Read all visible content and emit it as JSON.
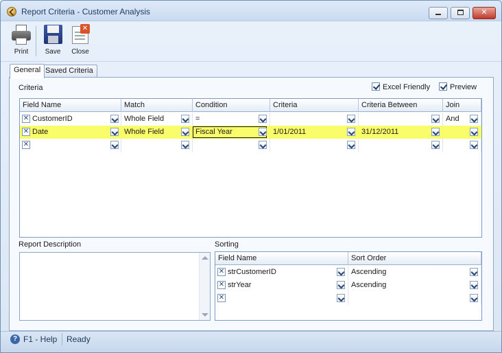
{
  "window": {
    "title": "Report Criteria - Customer Analysis"
  },
  "toolbar": {
    "print_label": "Print",
    "save_label": "Save",
    "close_label": "Close"
  },
  "tabs": [
    {
      "label": "General",
      "active": true
    },
    {
      "label": "Saved Criteria",
      "active": false
    }
  ],
  "criteria": {
    "section_label": "Criteria",
    "excel_friendly": {
      "label": "Excel Friendly",
      "checked": true
    },
    "preview": {
      "label": "Preview",
      "checked": true
    },
    "columns": [
      "Field Name",
      "Match",
      "Condition",
      "Criteria",
      "Criteria Between",
      "Join"
    ],
    "rows": [
      {
        "field": "CustomerID",
        "match": "Whole Field",
        "condition": "=",
        "criteria": "",
        "between": "",
        "join": "And",
        "selected": false
      },
      {
        "field": "Date",
        "match": "Whole Field",
        "condition": "Fiscal Year",
        "criteria": "1/01/2011",
        "between": "31/12/2011",
        "join": "",
        "selected": true
      },
      {
        "field": "",
        "match": "",
        "condition": "",
        "criteria": "",
        "between": "",
        "join": "",
        "selected": false
      }
    ]
  },
  "description": {
    "label": "Report Description",
    "value": ""
  },
  "sorting": {
    "label": "Sorting",
    "columns": [
      "Field Name",
      "Sort Order"
    ],
    "rows": [
      {
        "field": "strCustomerID",
        "order": "Ascending"
      },
      {
        "field": "strYear",
        "order": "Ascending"
      },
      {
        "field": "",
        "order": ""
      }
    ]
  },
  "status": {
    "help": "F1 - Help",
    "state": "Ready"
  },
  "colors": {
    "selected_row": "#fafd6a",
    "accent": "#3a68a8"
  }
}
